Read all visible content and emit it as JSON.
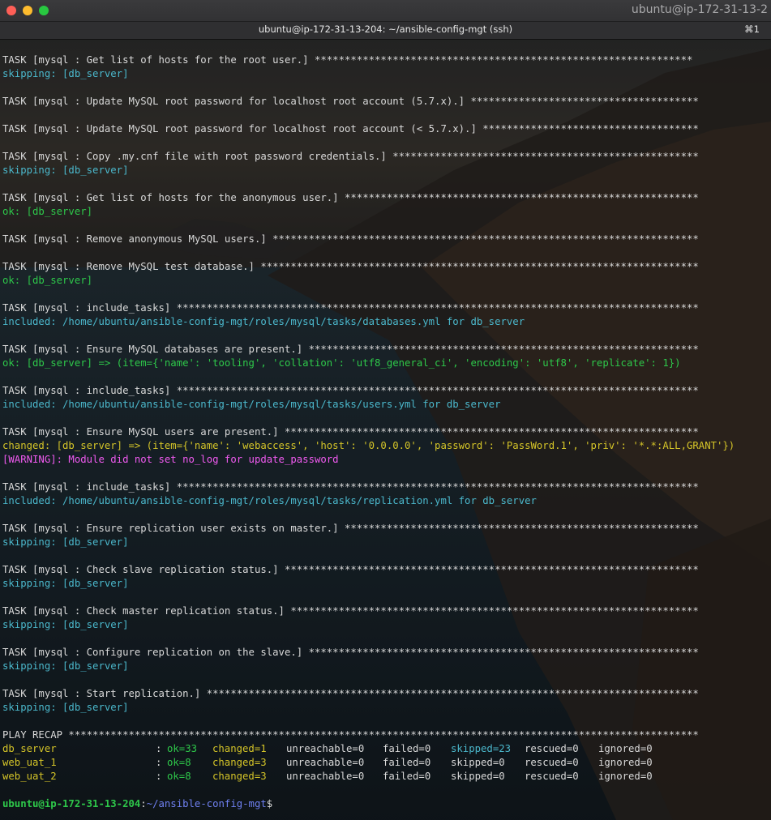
{
  "window": {
    "host_title": "ubuntu@ip-172-31-13-2",
    "tab_title": "ubuntu@ip-172-31-13-204: ~/ansible-config-mgt (ssh)",
    "tab_shortcut": "⌘1"
  },
  "lines": [
    {
      "type": "blank"
    },
    {
      "type": "text",
      "color": "white",
      "text": "TASK [mysql : Get list of hosts for the root user.] ***************************************************************"
    },
    {
      "type": "text",
      "color": "cyan",
      "text": "skipping: [db_server]"
    },
    {
      "type": "blank"
    },
    {
      "type": "text",
      "color": "white",
      "text": "TASK [mysql : Update MySQL root password for localhost root account (5.7.x).] **************************************"
    },
    {
      "type": "blank"
    },
    {
      "type": "text",
      "color": "white",
      "text": "TASK [mysql : Update MySQL root password for localhost root account (< 5.7.x).] ************************************"
    },
    {
      "type": "blank"
    },
    {
      "type": "text",
      "color": "white",
      "text": "TASK [mysql : Copy .my.cnf file with root password credentials.] ***************************************************"
    },
    {
      "type": "text",
      "color": "cyan",
      "text": "skipping: [db_server]"
    },
    {
      "type": "blank"
    },
    {
      "type": "text",
      "color": "white",
      "text": "TASK [mysql : Get list of hosts for the anonymous user.] ***********************************************************"
    },
    {
      "type": "text",
      "color": "green",
      "text": "ok: [db_server]"
    },
    {
      "type": "blank"
    },
    {
      "type": "text",
      "color": "white",
      "text": "TASK [mysql : Remove anonymous MySQL users.] ***********************************************************************"
    },
    {
      "type": "blank"
    },
    {
      "type": "text",
      "color": "white",
      "text": "TASK [mysql : Remove MySQL test database.] *************************************************************************"
    },
    {
      "type": "text",
      "color": "green",
      "text": "ok: [db_server]"
    },
    {
      "type": "blank"
    },
    {
      "type": "text",
      "color": "white",
      "text": "TASK [mysql : include_tasks] ***************************************************************************************"
    },
    {
      "type": "text",
      "color": "cyan",
      "text": "included: /home/ubuntu/ansible-config-mgt/roles/mysql/tasks/databases.yml for db_server"
    },
    {
      "type": "blank"
    },
    {
      "type": "text",
      "color": "white",
      "text": "TASK [mysql : Ensure MySQL databases are present.] *****************************************************************"
    },
    {
      "type": "text",
      "color": "green",
      "text": "ok: [db_server] => (item={'name': 'tooling', 'collation': 'utf8_general_ci', 'encoding': 'utf8', 'replicate': 1})"
    },
    {
      "type": "blank"
    },
    {
      "type": "text",
      "color": "white",
      "text": "TASK [mysql : include_tasks] ***************************************************************************************"
    },
    {
      "type": "text",
      "color": "cyan",
      "text": "included: /home/ubuntu/ansible-config-mgt/roles/mysql/tasks/users.yml for db_server"
    },
    {
      "type": "blank"
    },
    {
      "type": "text",
      "color": "white",
      "text": "TASK [mysql : Ensure MySQL users are present.] *********************************************************************"
    },
    {
      "type": "text",
      "color": "yellow",
      "text": "changed: [db_server] => (item={'name': 'webaccess', 'host': '0.0.0.0', 'password': 'PassWord.1', 'priv': '*.*:ALL,GRANT'})"
    },
    {
      "type": "text",
      "color": "magenta",
      "text": "[WARNING]: Module did not set no_log for update_password"
    },
    {
      "type": "blank"
    },
    {
      "type": "text",
      "color": "white",
      "text": "TASK [mysql : include_tasks] ***************************************************************************************"
    },
    {
      "type": "text",
      "color": "cyan",
      "text": "included: /home/ubuntu/ansible-config-mgt/roles/mysql/tasks/replication.yml for db_server"
    },
    {
      "type": "blank"
    },
    {
      "type": "text",
      "color": "white",
      "text": "TASK [mysql : Ensure replication user exists on master.] ***********************************************************"
    },
    {
      "type": "text",
      "color": "cyan",
      "text": "skipping: [db_server]"
    },
    {
      "type": "blank"
    },
    {
      "type": "text",
      "color": "white",
      "text": "TASK [mysql : Check slave replication status.] *********************************************************************"
    },
    {
      "type": "text",
      "color": "cyan",
      "text": "skipping: [db_server]"
    },
    {
      "type": "blank"
    },
    {
      "type": "text",
      "color": "white",
      "text": "TASK [mysql : Check master replication status.] ********************************************************************"
    },
    {
      "type": "text",
      "color": "cyan",
      "text": "skipping: [db_server]"
    },
    {
      "type": "blank"
    },
    {
      "type": "text",
      "color": "white",
      "text": "TASK [mysql : Configure replication on the slave.] *****************************************************************"
    },
    {
      "type": "text",
      "color": "cyan",
      "text": "skipping: [db_server]"
    },
    {
      "type": "blank"
    },
    {
      "type": "text",
      "color": "white",
      "text": "TASK [mysql : Start replication.] **********************************************************************************"
    },
    {
      "type": "text",
      "color": "cyan",
      "text": "skipping: [db_server]"
    },
    {
      "type": "blank"
    },
    {
      "type": "text",
      "color": "white",
      "text": "PLAY RECAP *********************************************************************************************************"
    }
  ],
  "recap": [
    {
      "host": "db_server",
      "host_color": "yellow",
      "sep": ":",
      "ok": "ok=33",
      "changed": "changed=1",
      "unreachable": "unreachable=0",
      "failed": "failed=0",
      "skipped": "skipped=23",
      "skipped_color": "cyan",
      "rescued": "rescued=0",
      "ignored": "ignored=0"
    },
    {
      "host": "web_uat_1",
      "host_color": "yellow",
      "sep": ":",
      "ok": "ok=8",
      "changed": "changed=3",
      "unreachable": "unreachable=0",
      "failed": "failed=0",
      "skipped": "skipped=0",
      "skipped_color": "white",
      "rescued": "rescued=0",
      "ignored": "ignored=0"
    },
    {
      "host": "web_uat_2",
      "host_color": "yellow",
      "sep": ":",
      "ok": "ok=8",
      "changed": "changed=3",
      "unreachable": "unreachable=0",
      "failed": "failed=0",
      "skipped": "skipped=0",
      "skipped_color": "white",
      "rescued": "rescued=0",
      "ignored": "ignored=0"
    }
  ],
  "prompt": {
    "user_host": "ubuntu@ip-172-31-13-204",
    "colon": ":",
    "path": "~/ansible-config-mgt",
    "symbol": "$"
  },
  "colors": {
    "white": "#d9d9d9",
    "cyan": "#4bb8cc",
    "green": "#2ec84a",
    "yellow": "#d4c428",
    "magenta": "#f05af0",
    "blue": "#6f80f0"
  }
}
